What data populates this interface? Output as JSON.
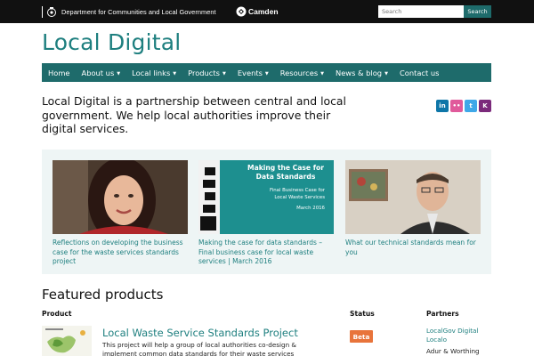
{
  "topbar": {
    "gov_name": "Department for Communities and Local Government",
    "camden": "Camden",
    "search_placeholder": "Search",
    "search_button": "Search"
  },
  "site": {
    "title": "Local Digital"
  },
  "nav": [
    {
      "label": "Home",
      "dropdown": false
    },
    {
      "label": "About us",
      "dropdown": true
    },
    {
      "label": "Local links",
      "dropdown": true
    },
    {
      "label": "Products",
      "dropdown": true
    },
    {
      "label": "Events",
      "dropdown": true
    },
    {
      "label": "Resources",
      "dropdown": true
    },
    {
      "label": "News & blog",
      "dropdown": true
    },
    {
      "label": "Contact us",
      "dropdown": false
    }
  ],
  "intro": "Local Digital is a partnership between central and local government. We help local authorities improve their digital services.",
  "social": [
    {
      "icon": "linkedin-icon",
      "label": "in",
      "color": "#0e76a8"
    },
    {
      "icon": "flickr-icon",
      "label": "••",
      "color": "#e05a9b"
    },
    {
      "icon": "twitter-icon",
      "label": "t",
      "color": "#3fa8e8"
    },
    {
      "icon": "k-icon",
      "label": "K",
      "color": "#7b2a7b"
    }
  ],
  "carousel": [
    {
      "caption": "Reflections on developing the business case for the waste services standards project"
    },
    {
      "caption": "Making the case for data standards – Final business case for local waste services | March 2016",
      "slide": {
        "title": "Making the Case for Data Standards",
        "subtitle": "Final Business Case for Local Waste Services",
        "date": "March 2016"
      }
    },
    {
      "caption": "What our technical standards mean for you"
    }
  ],
  "featured": {
    "heading": "Featured products",
    "col_product": "Product",
    "col_status": "Status",
    "col_partners": "Partners",
    "product": {
      "title": "Local Waste Service Standards Project",
      "description": "This project will help a group of local authorities co-design & implement common data standards for their waste services",
      "status": "Beta",
      "partners": [
        "LocalGov Digital",
        "Localo",
        "Adur & Worthing"
      ]
    }
  },
  "colors": {
    "brand": "#1e7f7f",
    "nav_bg": "#1e6b6b",
    "badge": "#e8743b"
  }
}
